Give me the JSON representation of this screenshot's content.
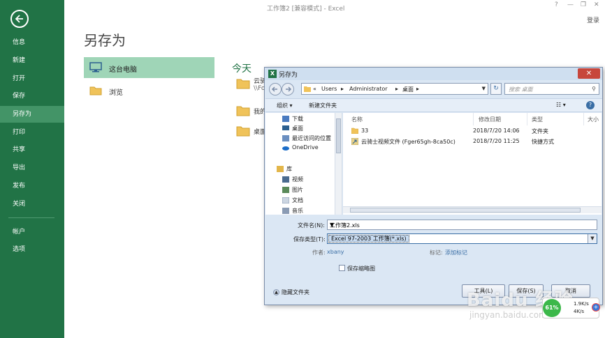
{
  "window": {
    "title": "工作簿2 [兼容模式] - Excel",
    "help": "?",
    "minimize": "—",
    "restore": "❐",
    "close": "✕",
    "signin": "登录"
  },
  "sidebar": {
    "items": [
      {
        "label": "信息"
      },
      {
        "label": "新建"
      },
      {
        "label": "打开"
      },
      {
        "label": "保存"
      },
      {
        "label": "另存为"
      },
      {
        "label": "打印"
      },
      {
        "label": "共享"
      },
      {
        "label": "导出"
      },
      {
        "label": "发布"
      },
      {
        "label": "关闭"
      },
      {
        "label": "帐户"
      },
      {
        "label": "选项"
      }
    ]
  },
  "main": {
    "heading": "另存为",
    "places": [
      {
        "label": "这台电脑"
      },
      {
        "label": "浏览"
      }
    ],
    "today": "今天",
    "recent": [
      {
        "line1": "云骑",
        "line2": "\\\\Fo"
      },
      {
        "line1": "我的"
      },
      {
        "line1": "桌面"
      }
    ]
  },
  "dialog": {
    "icon_text": "X",
    "title": "另存为",
    "close": "✕",
    "breadcrumbs": [
      "«",
      "Users",
      "▸",
      "Administrator",
      "▸",
      "桌面",
      "▸"
    ],
    "refresh": "↻",
    "search_placeholder": "搜索 桌面",
    "toolbar": {
      "organize": "组织 ▾",
      "new_folder": "新建文件夹",
      "view": "☷ ▾",
      "help": "?"
    },
    "nav": [
      {
        "label": "下载"
      },
      {
        "label": "桌面"
      },
      {
        "label": "最近访问的位置"
      },
      {
        "label": "OneDrive"
      },
      {
        "label": "库"
      },
      {
        "label": "视频"
      },
      {
        "label": "图片"
      },
      {
        "label": "文档"
      },
      {
        "label": "音乐"
      }
    ],
    "columns": {
      "name": "名称",
      "modified": "修改日期",
      "type": "类型",
      "size": "大小"
    },
    "files": [
      {
        "name": "33",
        "modified": "2018/7/20 14:06",
        "type": "文件夹"
      },
      {
        "name": "云骑士视频文件 (Fger65gh-8ca50c)",
        "modified": "2018/7/20 11:25",
        "type": "快捷方式"
      }
    ],
    "form": {
      "filename_label": "文件名(N):",
      "filename_value": "工作簿2.xls",
      "filetype_label": "保存类型(T):",
      "filetype_value": "Excel 97-2003 工作簿(*.xls)",
      "author_label": "作者:",
      "author_value": "xbany",
      "tags_label": "标记:",
      "tags_value": "添加标记",
      "thumbnail_label": "保存缩略图"
    },
    "hide_folders": "隐藏文件夹",
    "tools_button": "工具(L)",
    "save_button": "保存(S)",
    "cancel_button": "取消"
  },
  "overlay": {
    "speed_percent": "61%",
    "upload": "1.9K/s",
    "download": "4K/s",
    "badge": "+",
    "watermark": "Baidu 经验",
    "watermark_url": "jingyan.baidu.com"
  },
  "colors": {
    "excel_green": "#217346",
    "sidebar_active": "#439467",
    "place_selected": "#9fd5b7",
    "dialog_bg": "#dbe7f4"
  }
}
